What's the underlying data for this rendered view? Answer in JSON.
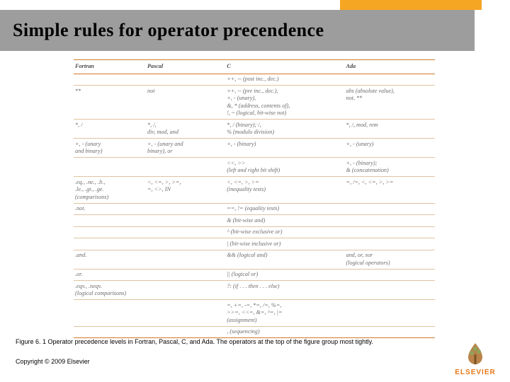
{
  "colors": {
    "accent_orange": "#f5a623",
    "title_bg": "#9d9d9d",
    "logo_orange": "#e67817"
  },
  "title": "Simple rules for operator precendence",
  "caption": "Figure 6. 1 Operator precedence levels in Fortran, Pascal, C, and Ada. The operators at the top of the figure group most tightly.",
  "copyright": "Copyright © 2009 Elsevier",
  "logo_text": "ELSEVIER",
  "headers": {
    "fortran": "Fortran",
    "pascal": "Pascal",
    "c": "C",
    "ada": "Ada"
  },
  "chart_data": {
    "type": "table",
    "title": "Figure 6.1 Operator precedence levels",
    "columns": [
      "Fortran",
      "Pascal",
      "C",
      "Ada"
    ],
    "rows": [
      {
        "f": "",
        "p": "",
        "c": "++, -- (post inc., dec.)",
        "a": ""
      },
      {
        "f": "**",
        "p": "not",
        "c": "++, -- (pre inc., dec.),\n+, - (unary),\n&, * (address, contents of),\n!, ~ (logical, bit-wise not)",
        "a": "abs (absolute value),\nnot, **"
      },
      {
        "f": "*, /",
        "p": "*, /,\ndiv, mod, and",
        "c": "*, / (binary); /,\n% (modulo division)",
        "a": "*, /, mod, rem"
      },
      {
        "f": "+, - (unary\nand binary)",
        "p": "+, - (unary and\nbinary), or",
        "c": "+, - (binary)",
        "a": "+, - (unary)"
      },
      {
        "f": "",
        "p": "",
        "c": "<<, >>\n(left and right bit shift)",
        "a": "+, - (binary);\n& (concatenation)"
      },
      {
        "f": ".eq., .ne., .lt.,\n.le., .gt., .ge.\n(comparisons)",
        "p": "<, <=, >, >=,\n=, <>, IN",
        "c": "<, <=, >, >=\n(inequality tests)",
        "a": "=, /=, <, <=, >, >="
      },
      {
        "f": ".not.",
        "p": "",
        "c": "==, != (equality tests)",
        "a": ""
      },
      {
        "f": "",
        "p": "",
        "c": "& (bit-wise and)",
        "a": ""
      },
      {
        "f": "",
        "p": "",
        "c": "^ (bit-wise exclusive or)",
        "a": ""
      },
      {
        "f": "",
        "p": "",
        "c": "| (bit-wise inclusive or)",
        "a": ""
      },
      {
        "f": ".and.",
        "p": "",
        "c": "&& (logical and)",
        "a": "and, or, xor\n(logical operators)"
      },
      {
        "f": ".or.",
        "p": "",
        "c": "|| (logical or)",
        "a": ""
      },
      {
        "f": ".eqv., .neqv.\n(logical comparisons)",
        "p": "",
        "c": "?: (if . . . then . . . else)",
        "a": ""
      },
      {
        "f": "",
        "p": "",
        "c": "=, +=, -=, *=, /=, %=,\n>>=, <<=, &=, ^=, |=\n(assignment)",
        "a": ""
      },
      {
        "f": "",
        "p": "",
        "c": ", (sequencing)",
        "a": ""
      }
    ]
  }
}
